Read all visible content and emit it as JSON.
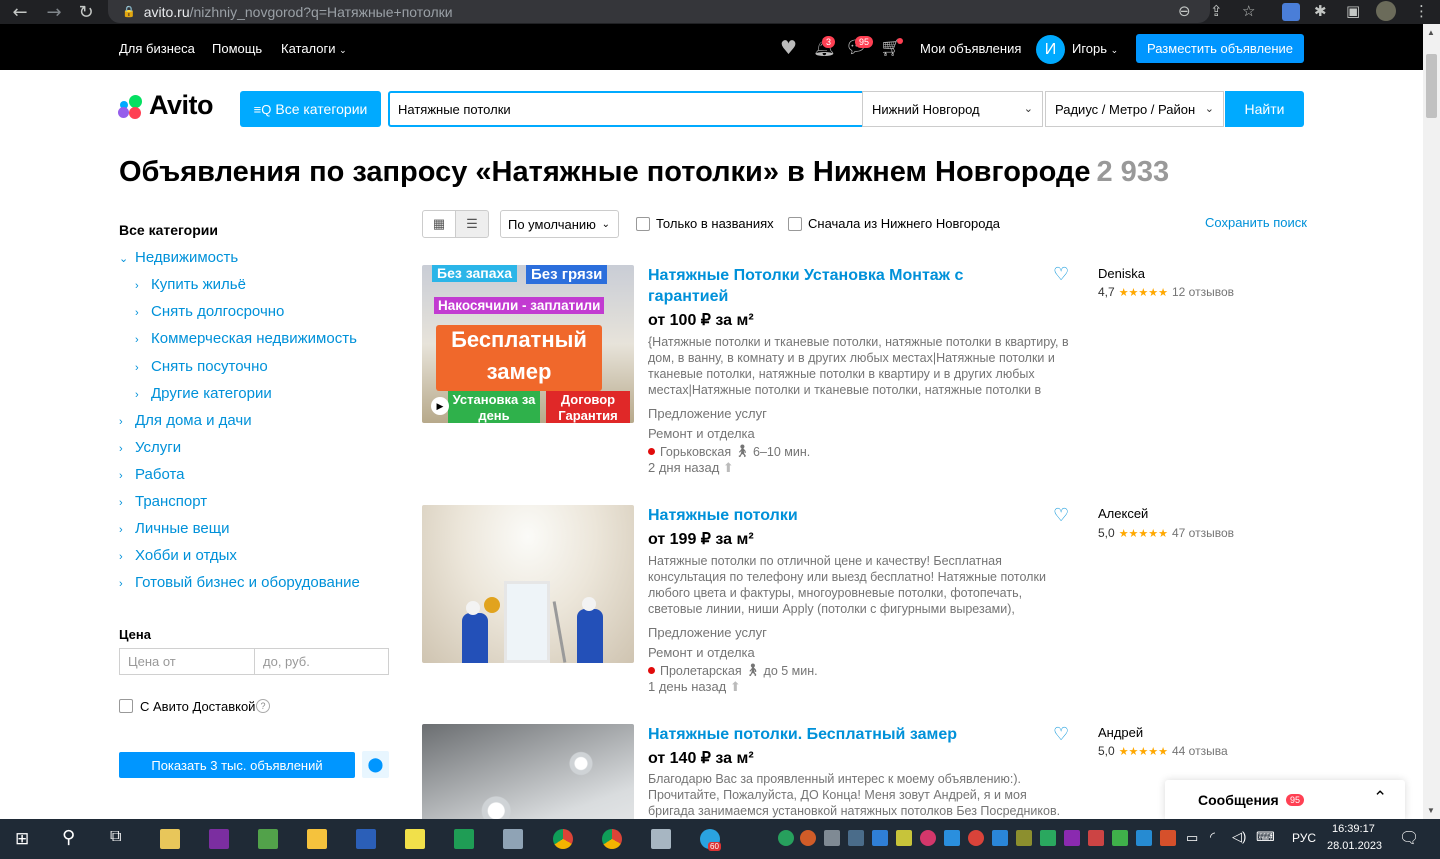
{
  "browser": {
    "url_host": "avito.ru",
    "url_path": "/nizhniy_novgorod?q=Натяжные+потолки",
    "icons": [
      "back-icon",
      "forward-icon",
      "reload-icon",
      "zoom-icon",
      "share-icon",
      "bookmark-star-icon",
      "translate-icon",
      "extensions-icon",
      "sidebar-icon",
      "profile-icon",
      "menu-icon"
    ]
  },
  "topnav": {
    "business": "Для бизнеса",
    "help": "Помощь",
    "catalogs": "Каталоги",
    "notif_count": "3",
    "msg_count": "95",
    "my_ads": "Мои объявления",
    "avatar_letter": "И",
    "user": "Игорь",
    "post_ad": "Разместить объявление"
  },
  "search": {
    "logo": "Avito",
    "all_categories": "Все категории",
    "query": "Натяжные потолки",
    "city": "Нижний Новгород",
    "radius": "Радиус / Метро / Район",
    "find": "Найти"
  },
  "page": {
    "title": "Объявления по запросу «Натяжные потолки» в Нижнем Новгороде",
    "count": "2 933"
  },
  "sidebar": {
    "header": "Все категории",
    "items": [
      {
        "label": "Недвижимость",
        "level": 0,
        "open": true
      },
      {
        "label": "Купить жильё",
        "level": 1
      },
      {
        "label": "Снять долгосрочно",
        "level": 1
      },
      {
        "label": "Коммерческая недвижимость",
        "level": 1
      },
      {
        "label": "Снять посуточно",
        "level": 1
      },
      {
        "label": "Другие категории",
        "level": 1
      },
      {
        "label": "Для дома и дачи",
        "level": 0
      },
      {
        "label": "Услуги",
        "level": 0
      },
      {
        "label": "Работа",
        "level": 0
      },
      {
        "label": "Транспорт",
        "level": 0
      },
      {
        "label": "Личные вещи",
        "level": 0
      },
      {
        "label": "Хобби и отдых",
        "level": 0
      },
      {
        "label": "Готовый бизнес и оборудование",
        "level": 0
      }
    ],
    "price_label": "Цена",
    "price_from": "Цена от",
    "price_to": "до, руб.",
    "delivery": "С Авито Доставкой",
    "show_button": "Показать 3 тыс. объявлений"
  },
  "toolbar": {
    "sort": "По умолчанию",
    "only_titles": "Только в названиях",
    "first_local": "Сначала из Нижнего Новгорода",
    "save_search": "Сохранить поиск"
  },
  "listings": [
    {
      "title": "Натяжные Потолки Установка Монтаж с гарантией",
      "price": "от 100 ₽ за м²",
      "desc": "{Натяжные потолки и тканевые потолки, натяжные потолки в квартиру, в дом, в ванну, в комнату и в других любых местах|Натяжные потолки и тканевые потолки, натяжные потолки в квартиру и в других любых местах|Натяжные потолки и тканевые потолки, натяжные потолки в",
      "type": "Предложение услуг",
      "category": "Ремонт и отделка",
      "metro": "Горьковская",
      "walk": "6–10 мин.",
      "date": "2 дня назад",
      "seller": "Deniska",
      "rating": "4,7",
      "reviews": "12 отзывов",
      "photo_text": [
        "Без запаха",
        "Без грязи",
        "Накосячили - заплатили",
        "Бесплатный",
        "замер",
        "Установка за день",
        "Договор Гарантия"
      ]
    },
    {
      "title": "Натяжные потолки",
      "price": "от 199 ₽ за м²",
      "desc": "Натяжные потолки по отличной цене и качеству! Бесплатная консультация по телефону или выезд бесплатно! Натяжные потолки любого цвета и фактуры, многоуровневые потолки, фотопечать, световые линии, ниши Apply (потолки с фигурными вырезами),",
      "type": "Предложение услуг",
      "category": "Ремонт и отделка",
      "metro": "Пролетарская",
      "walk": "до 5 мин.",
      "date": "1 день назад",
      "seller": "Алексей",
      "rating": "5,0",
      "reviews": "47 отзывов"
    },
    {
      "title": "Натяжные потолки. Бесплатный замер",
      "price": "от 140 ₽ за м²",
      "desc": "Благодарю Вас за проявленный интерес к моему объявлению:). Прочитайте, Пожалуйста, ДО Конца! Меня зовут Андрей, я и моя бригада занимаемся установкой натяжных потолков Без Посредников.",
      "seller": "Андрей",
      "rating": "5,0",
      "reviews": "44 отзыва"
    }
  ],
  "messages": {
    "label": "Сообщения",
    "count": "95"
  },
  "taskbar": {
    "lang": "РУС",
    "time": "16:39:17",
    "date": "28.01.2023",
    "telegram_badge": "60"
  },
  "colors": {
    "accent": "#0af",
    "link": "#0091d9",
    "badge": "#ff4053",
    "star": "#ffa800"
  }
}
